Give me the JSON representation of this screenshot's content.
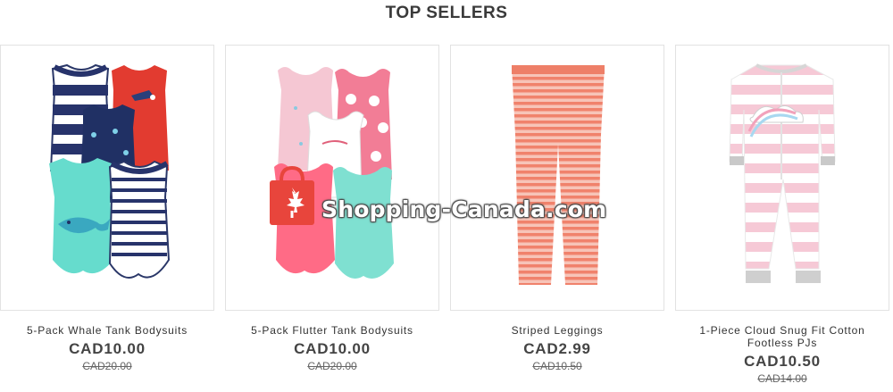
{
  "section": {
    "title": "TOP SELLERS"
  },
  "products": [
    {
      "name": "5-Pack Whale Tank Bodysuits",
      "price": "CAD10.00",
      "old_price": "CAD20.00"
    },
    {
      "name": "5-Pack Flutter Tank Bodysuits",
      "price": "CAD10.00",
      "old_price": "CAD20.00"
    },
    {
      "name": "Striped Leggings",
      "price": "CAD2.99",
      "old_price": "CAD10.50"
    },
    {
      "name": "1-Piece Cloud Snug Fit Cotton Footless PJs",
      "price": "CAD10.50",
      "old_price": "CAD14.00"
    }
  ],
  "watermark": {
    "text": "Shopping-Canada.com"
  },
  "colors": {
    "sale_text": "#444444",
    "watermark_red": "#e8453c"
  }
}
